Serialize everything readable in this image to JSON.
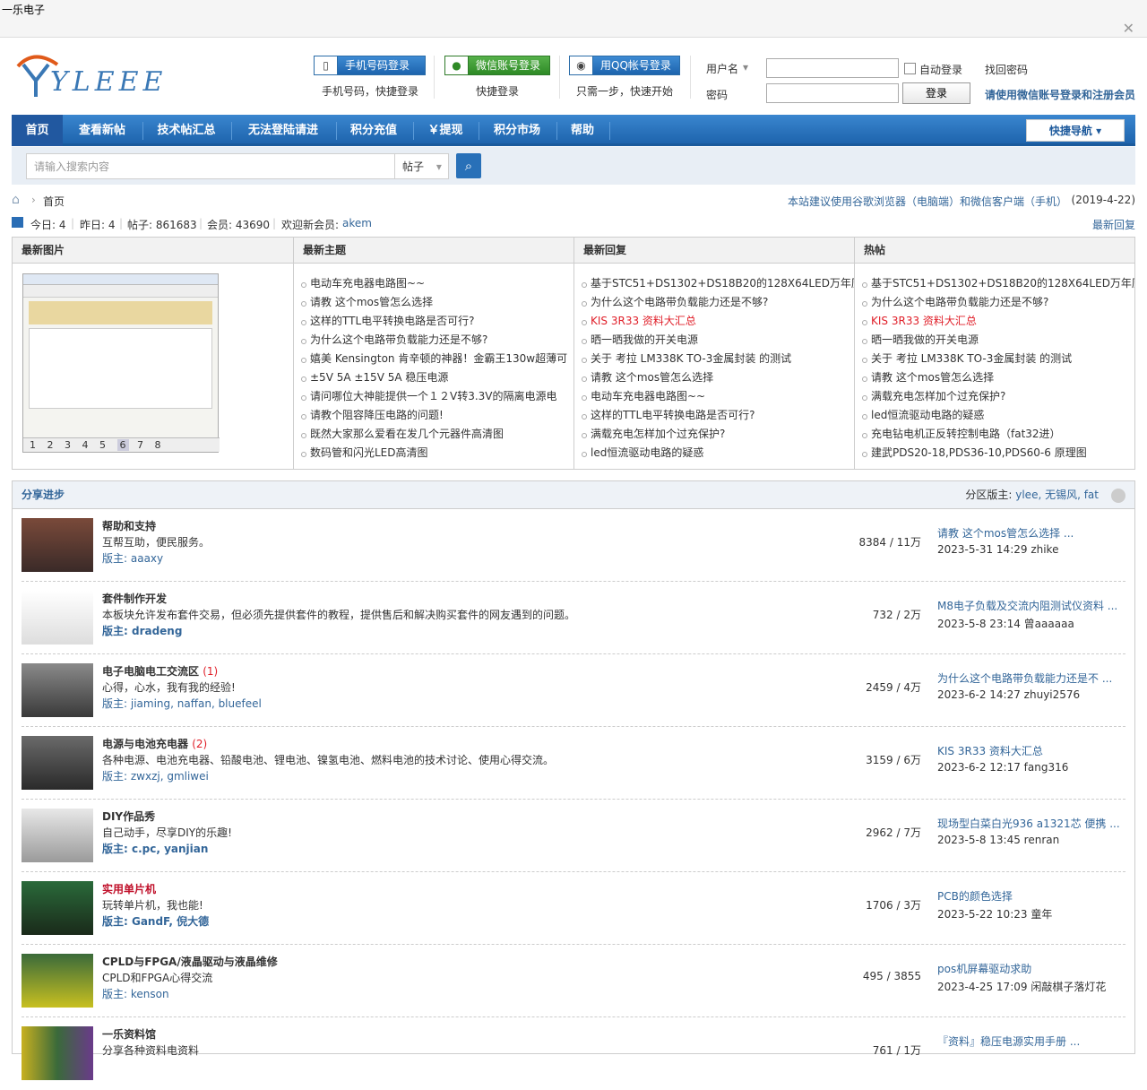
{
  "window": {
    "title": "一乐电子"
  },
  "logo": {
    "text": "YLEEE"
  },
  "login": {
    "phone": {
      "label": "手机号码登录",
      "sub": "手机号码，快捷登录"
    },
    "wechat": {
      "label": "微信账号登录",
      "sub": "快捷登录"
    },
    "qq": {
      "label": "用QQ帐号登录",
      "sub": "只需一步，快速开始"
    },
    "username_label": "用户名",
    "password_label": "密码",
    "auto_login": "自动登录",
    "login_button": "登录",
    "forgot": "找回密码",
    "wechat_register": "请使用微信账号登录和注册会员"
  },
  "nav": {
    "items": [
      "首页",
      "查看新帖",
      "技术帖汇总",
      "无法登陆请进",
      "积分充值",
      "￥提现",
      "积分市场",
      "帮助"
    ],
    "quick": "快捷导航"
  },
  "search": {
    "placeholder": "请输入搜索内容",
    "type": "帖子"
  },
  "breadcrumb": {
    "current": "首页",
    "notice": "本站建议使用谷歌浏览器（电脑端）和微信客户端（手机）",
    "date": "(2019-4-22)"
  },
  "stats": {
    "today": "今日: 4",
    "yesterday": "昨日: 4",
    "posts": "帖子: 861683",
    "members": "会员: 43690",
    "welcome": "欢迎新会员:",
    "new_member": "akem",
    "latest_reply": "最新回复"
  },
  "panels": {
    "images_title": "最新图片",
    "pager": [
      "1",
      "2",
      "3",
      "4",
      "5",
      "6",
      "7",
      "8"
    ],
    "new_topics": {
      "title": "最新主题",
      "items": [
        "电动车充电器电路图~~",
        "请教 这个mos管怎么选择",
        "这样的TTL电平转换电路是否可行?",
        "为什么这个电路带负载能力还是不够?",
        "嬉美 Kensington 肯辛顿的神器！金霸王130w超薄可",
        "±5V 5A ±15V 5A 稳压电源",
        "请问哪位大神能提供一个１２V转3.3V的隔离电源电",
        "请教个阻容降压电路的问题!",
        "既然大家那么爱看在发几个元器件高清图",
        "数码管和闪光LED高清图"
      ]
    },
    "new_replies": {
      "title": "最新回复",
      "items": [
        "基于STC51+DS1302+DS18B20的128X64LED万年历",
        "为什么这个电路带负载能力还是不够?",
        "KIS 3R33 资料大汇总",
        "晒一晒我做的开关电源",
        "关于 考拉 LM338K TO-3金属封装 的测试",
        "请教 这个mos管怎么选择",
        "电动车充电器电路图~~",
        "这样的TTL电平转换电路是否可行?",
        "满载充电怎样加个过充保护?",
        "led恒流驱动电路的疑惑"
      ]
    },
    "hot": {
      "title": "热帖",
      "items": [
        "基于STC51+DS1302+DS18B20的128X64LED万年历",
        "为什么这个电路带负载能力还是不够?",
        "KIS 3R33 资料大汇总",
        "晒一晒我做的开关电源",
        "关于 考拉 LM338K TO-3金属封装 的测试",
        "请教 这个mos管怎么选择",
        "满载充电怎样加个过充保护?",
        "led恒流驱动电路的疑惑",
        "充电钻电机正反转控制电路（fat32进）",
        "建武PDS20-18,PDS36-10,PDS60-6 原理图"
      ]
    }
  },
  "forum": {
    "title": "分享进步",
    "mods_label": "分区版主:",
    "mods": "ylee, 无锡风, fat",
    "rows": [
      {
        "name": "帮助和支持",
        "extra": "",
        "desc": "互帮互助，便民服务。",
        "mods": "版主: aaaxy",
        "count": "8384 / 11万",
        "last_title": "请教 这个mos管怎么选择 ...",
        "last_meta": "2023-5-31 14:29 zhike"
      },
      {
        "name": "套件制作开发",
        "extra": "",
        "desc": "本板块允许发布套件交易，但必须先提供套件的教程，提供售后和解决购买套件的网友遇到的问题。",
        "mods": "版主: dradeng",
        "count": "732 / 2万",
        "last_title": "M8电子负载及交流内阻测试仪资料 ...",
        "last_meta": "2023-5-8 23:14 曾aaaaaa"
      },
      {
        "name": "电子电脑电工交流区",
        "extra": "(1)",
        "desc": "心得，心水，我有我的经验!",
        "mods": "版主: jiaming, naffan, bluefeel",
        "count": "2459 / 4万",
        "last_title": "为什么这个电路带负载能力还是不 ...",
        "last_meta": "2023-6-2 14:27 zhuyi2576"
      },
      {
        "name": "电源与电池充电器",
        "extra": "(2)",
        "desc": "各种电源、电池充电器、铅酸电池、锂电池、镍氢电池、燃料电池的技术讨论、使用心得交流。",
        "mods": "版主: zwxzj, gmliwei",
        "count": "3159 / 6万",
        "last_title": "KIS 3R33 资料大汇总",
        "last_meta": "2023-6-2 12:17 fang316"
      },
      {
        "name": "DIY作品秀",
        "extra": "",
        "desc": "自己动手，尽享DIY的乐趣!",
        "mods": "版主: c.pc, yanjian",
        "count": "2962 / 7万",
        "last_title": "现场型白菜白光936 a1321芯 便携 ...",
        "last_meta": "2023-5-8 13:45 renran"
      },
      {
        "name": "实用单片机",
        "extra": "",
        "desc": "玩转单片机，我也能!",
        "mods": "版主: GandF, 倪大德",
        "count": "1706 / 3万",
        "last_title": "PCB的颜色选择",
        "last_meta": "2023-5-22 10:23 童年"
      },
      {
        "name": "CPLD与FPGA/液晶驱动与液晶维修",
        "extra": "",
        "desc": "CPLD和FPGA心得交流",
        "mods": "版主: kenson",
        "count": "495 / 3855",
        "last_title": "pos机屏幕驱动求助",
        "last_meta": "2023-4-25 17:09 闲敲棋子落灯花"
      },
      {
        "name": "一乐资料馆",
        "extra": "",
        "desc": "分享各种资料电资料",
        "mods": "",
        "count": "761 / 1万",
        "last_title": "『资料』稳压电源实用手册 ...",
        "last_meta": ""
      }
    ]
  }
}
